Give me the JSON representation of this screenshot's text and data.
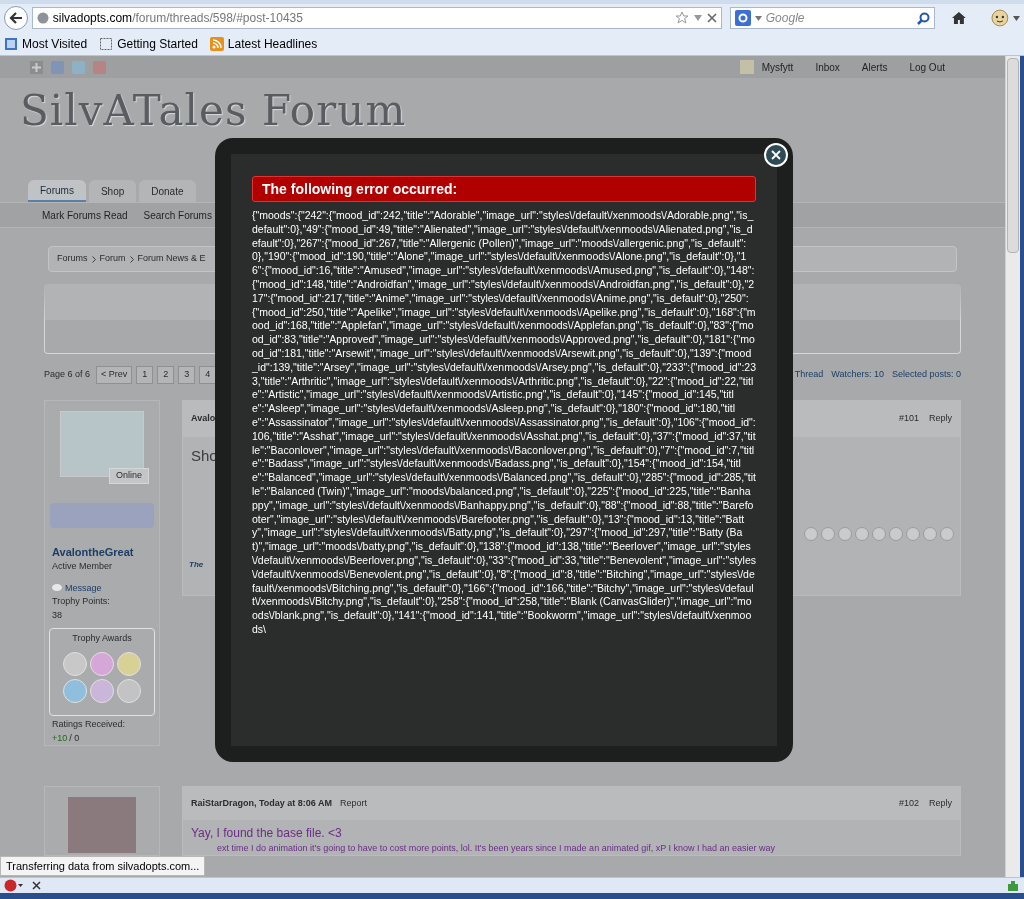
{
  "browser": {
    "url_host": "silvadopts.com",
    "url_path": "/forum/threads/598/#post-10435",
    "search_placeholder": "Google",
    "bookmarks": [
      {
        "kind": "folder",
        "label": "Most Visited"
      },
      {
        "kind": "page",
        "label": "Getting Started"
      },
      {
        "kind": "feed",
        "label": "Latest Headlines"
      }
    ],
    "status": "Transferring data from silvadopts.com..."
  },
  "forum": {
    "user_menu": [
      "Mysfytt",
      "Inbox",
      "Alerts",
      "Log Out"
    ],
    "logo": "SilvATales Forum",
    "tabs": [
      {
        "label": "Forums",
        "selected": true
      },
      {
        "label": "Shop",
        "selected": false
      },
      {
        "label": "Donate",
        "selected": false
      }
    ],
    "subnav": [
      "Mark Forums Read",
      "Search Forums"
    ],
    "breadcrumbs": [
      "Forums",
      "Forum",
      "Forum News & E"
    ],
    "page_nav": {
      "label": "Page 6 of 6",
      "prev": "< Prev",
      "pages": [
        "1",
        "2",
        "3",
        "4"
      ]
    },
    "thread_tools": [
      "Thread",
      "Watchers: 10",
      "Selected posts: 0"
    ],
    "user": {
      "online": "Online",
      "name": "AvalontheGreat",
      "title": "Active Member",
      "message": "Message",
      "trophy_label": "Trophy Points:",
      "trophy_points": "38",
      "awards_title": "Trophy Awards",
      "ratings_label": "Ratings Received:",
      "ratings_positive": "+10",
      "ratings_rest": "/ 0"
    },
    "posts": [
      {
        "author": "Avalo",
        "number": "#101",
        "reply": "Reply",
        "body": "Sho",
        "footer": "The"
      },
      {
        "author": "RaiStarDragon, Today at 8:06 AM",
        "report": "Report",
        "number": "#102",
        "reply": "Reply",
        "body": "Yay, I found the base file. <3",
        "body_2": "ext time I do animation it's going to have to cost more points, lol. It's been years since I made an animated gif, xP I know I had an easier way"
      }
    ]
  },
  "modal": {
    "title": "The following error occurred:",
    "message": "{\"moods\":{\"242\":{\"mood_id\":242,\"title\":\"Adorable\",\"image_url\":\"styles\\/default\\/xenmoods\\/Adorable.png\",\"is_default\":0},\"49\":{\"mood_id\":49,\"title\":\"Alienated\",\"image_url\":\"styles\\/default\\/xenmoods\\/Alienated.png\",\"is_default\":0},\"267\":{\"mood_id\":267,\"title\":\"Allergenic (Pollen)\",\"image_url\":\"moods\\/allergenic.png\",\"is_default\":0},\"190\":{\"mood_id\":190,\"title\":\"Alone\",\"image_url\":\"styles\\/default\\/xenmoods\\/Alone.png\",\"is_default\":0},\"16\":{\"mood_id\":16,\"title\":\"Amused\",\"image_url\":\"styles\\/default\\/xenmoods\\/Amused.png\",\"is_default\":0},\"148\":{\"mood_id\":148,\"title\":\"Androidfan\",\"image_url\":\"styles\\/default\\/xenmoods\\/Androidfan.png\",\"is_default\":0},\"217\":{\"mood_id\":217,\"title\":\"Anime\",\"image_url\":\"styles\\/default\\/xenmoods\\/Anime.png\",\"is_default\":0},\"250\":{\"mood_id\":250,\"title\":\"Apelike\",\"image_url\":\"styles\\/default\\/xenmoods\\/Apelike.png\",\"is_default\":0},\"168\":{\"mood_id\":168,\"title\":\"Applefan\",\"image_url\":\"styles\\/default\\/xenmoods\\/Applefan.png\",\"is_default\":0},\"83\":{\"mood_id\":83,\"title\":\"Approved\",\"image_url\":\"styles\\/default\\/xenmoods\\/Approved.png\",\"is_default\":0},\"181\":{\"mood_id\":181,\"title\":\"Arsewit\",\"image_url\":\"styles\\/default\\/xenmoods\\/Arsewit.png\",\"is_default\":0},\"139\":{\"mood_id\":139,\"title\":\"Arsey\",\"image_url\":\"styles\\/default\\/xenmoods\\/Arsey.png\",\"is_default\":0},\"233\":{\"mood_id\":233,\"title\":\"Arthritic\",\"image_url\":\"styles\\/default\\/xenmoods\\/Arthritic.png\",\"is_default\":0},\"22\":{\"mood_id\":22,\"title\":\"Artistic\",\"image_url\":\"styles\\/default\\/xenmoods\\/Artistic.png\",\"is_default\":0},\"145\":{\"mood_id\":145,\"title\":\"Asleep\",\"image_url\":\"styles\\/default\\/xenmoods\\/Asleep.png\",\"is_default\":0},\"180\":{\"mood_id\":180,\"title\":\"Assassinator\",\"image_url\":\"styles\\/default\\/xenmoods\\/Assassinator.png\",\"is_default\":0},\"106\":{\"mood_id\":106,\"title\":\"Asshat\",\"image_url\":\"styles\\/default\\/xenmoods\\/Asshat.png\",\"is_default\":0},\"37\":{\"mood_id\":37,\"title\":\"Baconlover\",\"image_url\":\"styles\\/default\\/xenmoods\\/Baconlover.png\",\"is_default\":0},\"7\":{\"mood_id\":7,\"title\":\"Badass\",\"image_url\":\"styles\\/default\\/xenmoods\\/Badass.png\",\"is_default\":0},\"154\":{\"mood_id\":154,\"title\":\"Balanced\",\"image_url\":\"styles\\/default\\/xenmoods\\/Balanced.png\",\"is_default\":0},\"285\":{\"mood_id\":285,\"title\":\"Balanced (Twin)\",\"image_url\":\"moods\\/balanced.png\",\"is_default\":0},\"225\":{\"mood_id\":225,\"title\":\"Banhappy\",\"image_url\":\"styles\\/default\\/xenmoods\\/Banhappy.png\",\"is_default\":0},\"88\":{\"mood_id\":88,\"title\":\"Barefooter\",\"image_url\":\"styles\\/default\\/xenmoods\\/Barefooter.png\",\"is_default\":0},\"13\":{\"mood_id\":13,\"title\":\"Batty\",\"image_url\":\"styles\\/default\\/xenmoods\\/Batty.png\",\"is_default\":0},\"297\":{\"mood_id\":297,\"title\":\"Batty (Bat)\",\"image_url\":\"moods\\/batty.png\",\"is_default\":0},\"138\":{\"mood_id\":138,\"title\":\"Beerlover\",\"image_url\":\"styles\\/default\\/xenmoods\\/Beerlover.png\",\"is_default\":0},\"33\":{\"mood_id\":33,\"title\":\"Benevolent\",\"image_url\":\"styles\\/default\\/xenmoods\\/Benevolent.png\",\"is_default\":0},\"8\":{\"mood_id\":8,\"title\":\"Bitching\",\"image_url\":\"styles\\/default\\/xenmoods\\/Bitching.png\",\"is_default\":0},\"166\":{\"mood_id\":166,\"title\":\"Bitchy\",\"image_url\":\"styles\\/default\\/xenmoods\\/Bitchy.png\",\"is_default\":0},\"258\":{\"mood_id\":258,\"title\":\"Blank (CanvasGlider)\",\"image_url\":\"moods\\/blank.png\",\"is_default\":0},\"141\":{\"mood_id\":141,\"title\":\"Bookworm\",\"image_url\":\"styles\\/default\\/xenmoods\\"
  }
}
